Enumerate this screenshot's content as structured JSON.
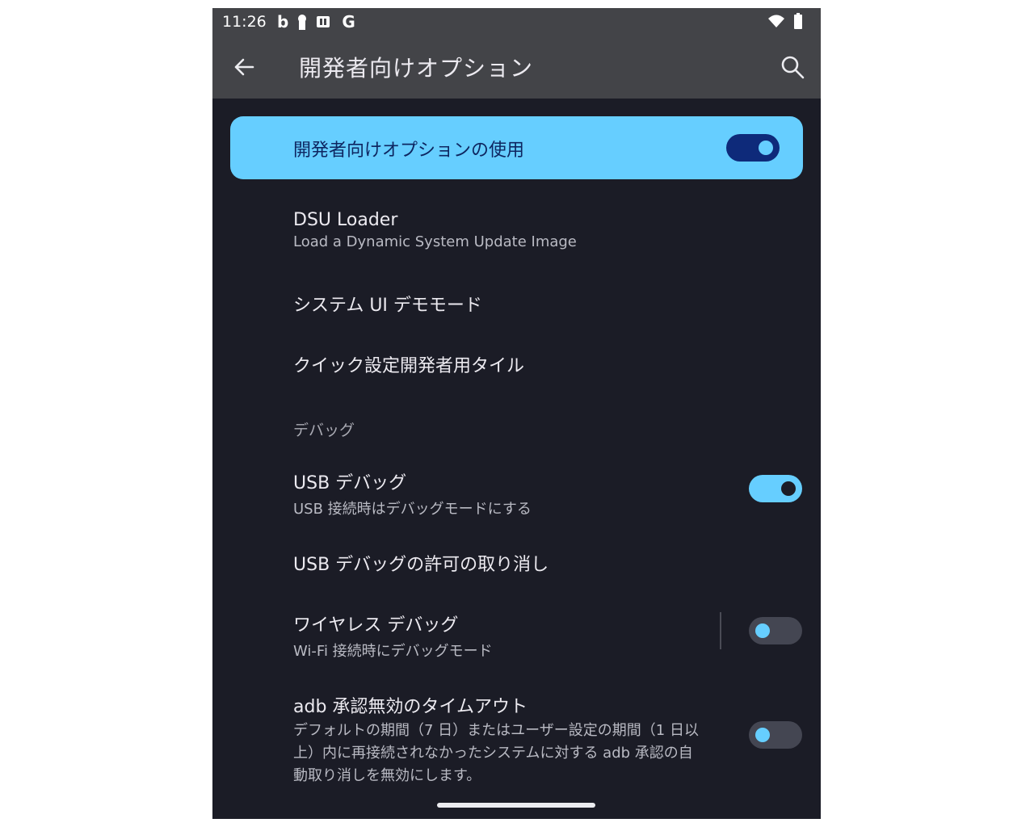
{
  "status_bar": {
    "time": "11:26",
    "left_icons": [
      "bing-icon",
      "keyhole-icon",
      "sim-icon",
      "google-icon"
    ],
    "right_icons": [
      "wifi-icon",
      "battery-icon"
    ]
  },
  "app_bar": {
    "title": "開発者向けオプション",
    "back_icon": "back-arrow-icon",
    "search_icon": "search-icon"
  },
  "master_switch": {
    "label": "開発者向けオプションの使用",
    "on": true
  },
  "items": [
    {
      "title": "DSU Loader",
      "subtitle": "Load a Dynamic System Update Image"
    },
    {
      "title": "システム UI デモモード"
    },
    {
      "title": "クイック設定開発者用タイル"
    }
  ],
  "section": {
    "header": "デバッグ"
  },
  "debug_items": [
    {
      "title": "USB デバッグ",
      "subtitle": "USB 接続時はデバッグモードにする",
      "toggle": true
    },
    {
      "title": "USB デバッグの許可の取り消し"
    },
    {
      "title": "ワイヤレス デバッグ",
      "subtitle": "Wi-Fi 接続時にデバッグモード",
      "toggle": false
    },
    {
      "title": "adb 承認無効のタイムアウト",
      "subtitle_lines": [
        "デフォルトの期間（7 日）またはユーザー設定の期間（1 日以",
        "上）内に再接続されなかったシステムに対する adb 承認の自",
        "動取り消しを無効にします。"
      ],
      "toggle": false
    }
  ],
  "colors": {
    "accent": "#66ceff",
    "background": "#1b1c26",
    "bar": "#434448",
    "master_toggle_track": "#0e2a7a"
  }
}
